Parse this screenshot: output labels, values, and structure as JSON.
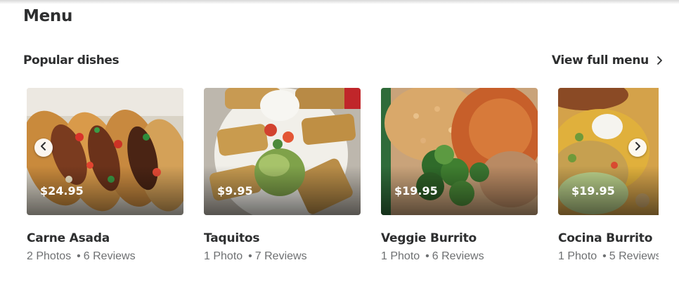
{
  "section": {
    "title": "Menu"
  },
  "popular": {
    "title": "Popular dishes",
    "view_full_menu": "View full menu"
  },
  "dishes": [
    {
      "name": "Carne Asada",
      "price": "$24.95",
      "photos": "2 Photos",
      "reviews": "6 Reviews",
      "bullet": "•"
    },
    {
      "name": "Taquitos",
      "price": "$9.95",
      "photos": "1 Photo",
      "reviews": "7 Reviews",
      "bullet": "•"
    },
    {
      "name": "Veggie Burrito",
      "price": "$19.95",
      "photos": "1 Photo",
      "reviews": "6 Reviews",
      "bullet": "•"
    },
    {
      "name": "Cocina Burrito",
      "price": "$19.95",
      "photos": "1 Photo",
      "reviews": "5 Reviews",
      "bullet": "•"
    }
  ],
  "icons": {
    "prev": "chevron-left-icon",
    "next": "chevron-right-icon",
    "view_menu": "chevron-right-icon"
  }
}
